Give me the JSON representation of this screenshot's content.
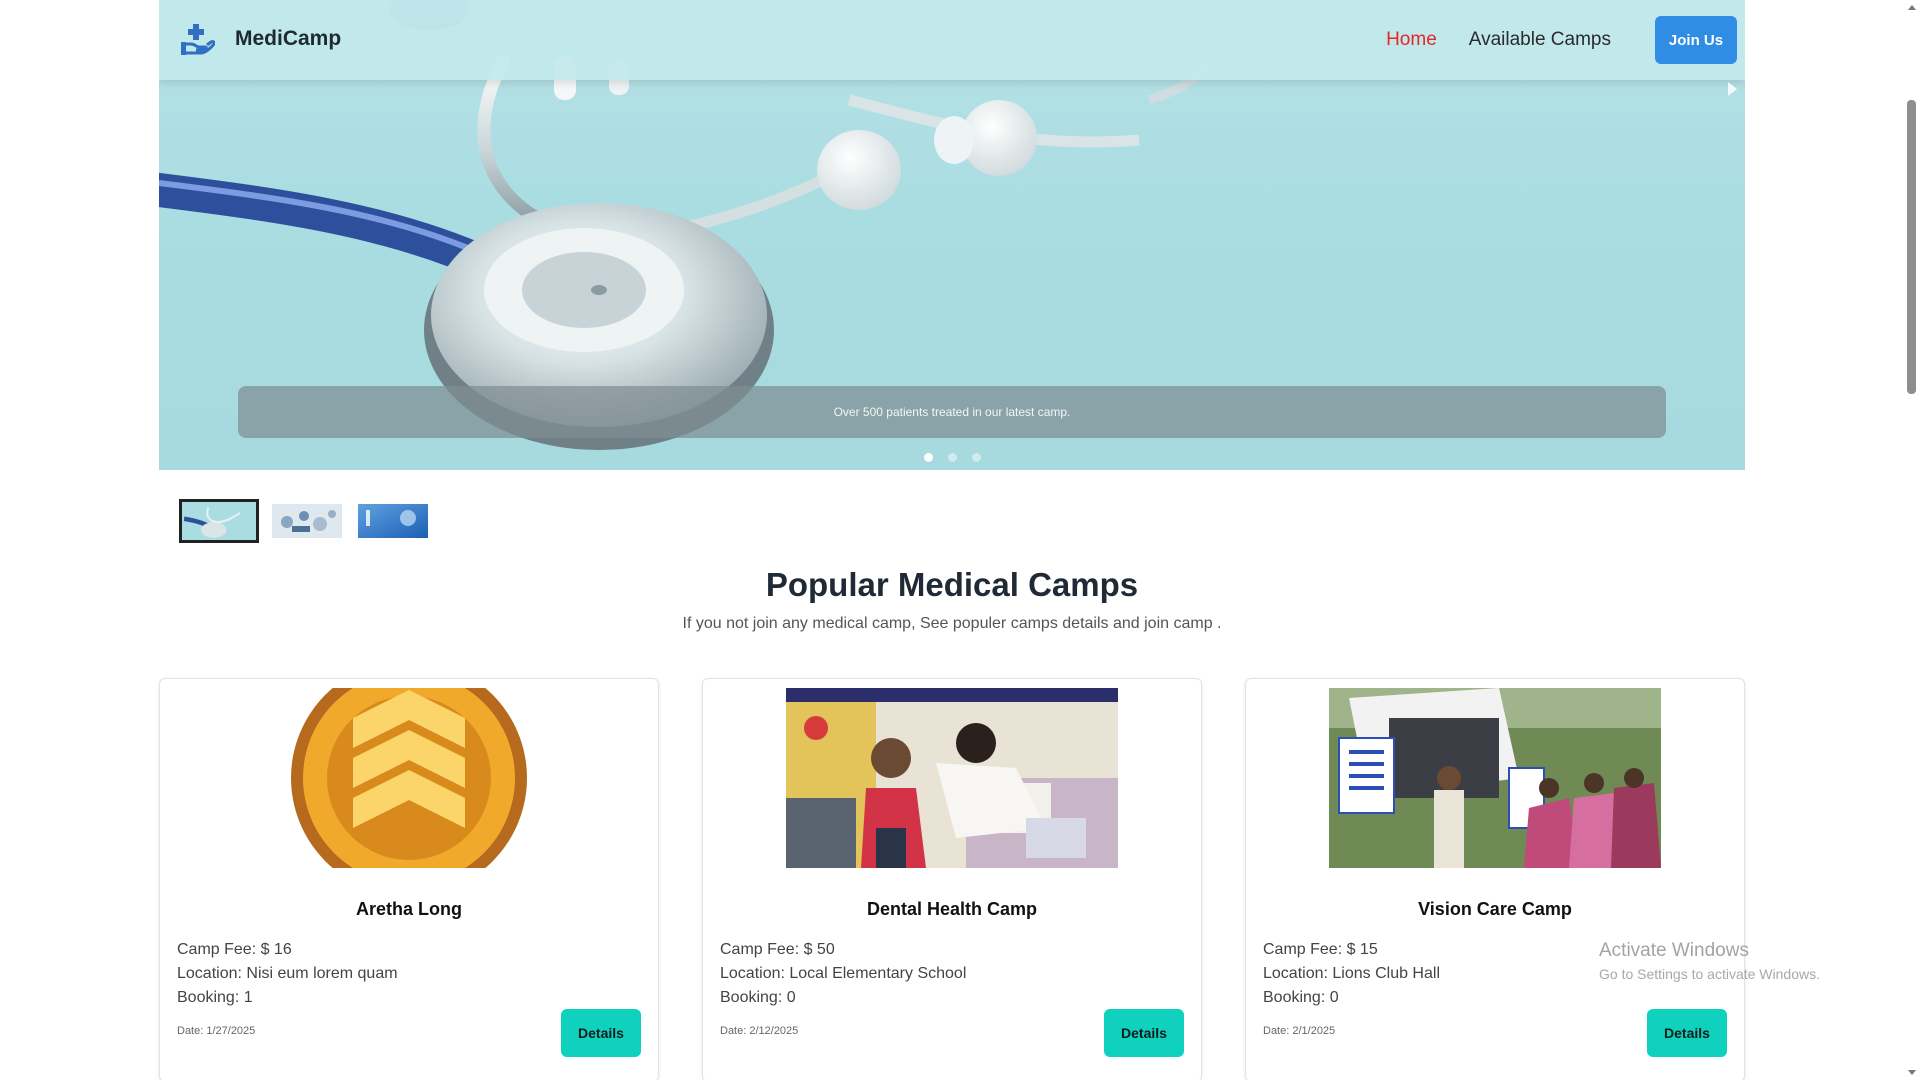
{
  "navbar": {
    "brand_name": "MediCamp",
    "brand_icon": "medical-hand-icon",
    "links": [
      {
        "label": "Home",
        "active": true
      },
      {
        "label": "Available Camps",
        "active": false
      }
    ],
    "join_label": "Join Us",
    "accent_active": "#e5262b",
    "join_color": "#2f8de4"
  },
  "hero": {
    "caption": "Over 500 patients treated in our latest camp.",
    "slide_count": 3,
    "active_slide": 1
  },
  "thumbnails": {
    "count": 3,
    "active": 1
  },
  "section": {
    "title": "Popular Medical Camps",
    "subtitle": "If you not join any medical camp, See populer camps details and join camp ."
  },
  "cards": [
    {
      "title": "Aretha Long",
      "fee": "Camp Fee: $ 16",
      "location": "Location: Nisi eum lorem quam",
      "booking": "Booking: 1",
      "date": "Date: 1/27/2025",
      "button": "Details"
    },
    {
      "title": "Dental Health Camp",
      "fee": "Camp Fee: $ 50",
      "location": "Location: Local Elementary School",
      "booking": "Booking: 0",
      "date": "Date: 2/12/2025",
      "button": "Details"
    },
    {
      "title": "Vision Care Camp",
      "fee": "Camp Fee: $ 15",
      "location": "Location: Lions Club Hall",
      "booking": "Booking: 0",
      "date": "Date: 2/1/2025",
      "button": "Details"
    }
  ],
  "watermark": {
    "title": "Activate Windows",
    "subtitle": "Go to Settings to activate Windows."
  },
  "colors": {
    "details_button": "#10d1bd",
    "hero_bg": "#a9dde2"
  }
}
